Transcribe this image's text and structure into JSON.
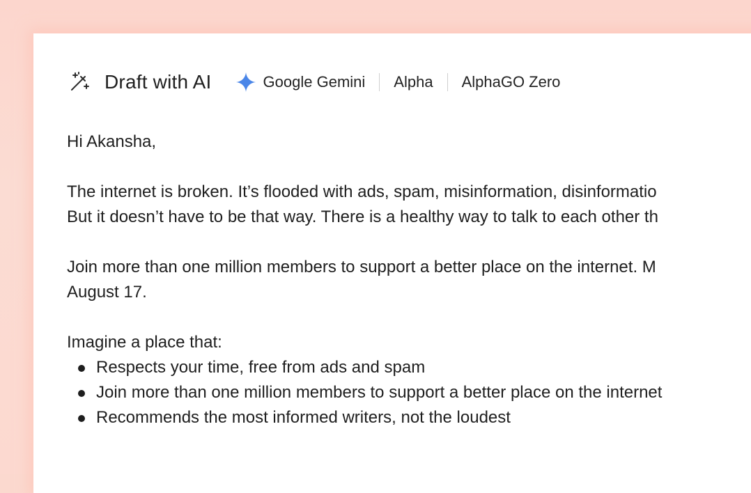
{
  "toolbar": {
    "title": "Draft with AI",
    "icon": "magic-wand-icon",
    "models": [
      {
        "label": "Google Gemini",
        "icon": "gemini-sparkle-icon",
        "icon_color": "#4a86e8"
      },
      {
        "label": "Alpha"
      },
      {
        "label": "AlphaGO Zero"
      }
    ]
  },
  "email": {
    "greeting": "Hi Akansha,",
    "paragraph1_line1": "The internet is broken. It’s flooded with ads, spam, misinformation, disinformatio",
    "paragraph1_line2": "But it doesn’t have to be that way. There is a healthy way to talk to each other th",
    "paragraph2_line1": "Join more than one million members to support a better place on the internet. M",
    "paragraph2_line2": "August 17.",
    "list_intro": "Imagine a place that:",
    "bullets": [
      "Respects your time, free from ads and spam",
      "Join more than one million members to support a better place on the internet",
      "Recommends the most informed writers, not the loudest"
    ]
  },
  "colors": {
    "background": "#fbd9cf",
    "card": "#ffffff",
    "text": "#1e1e1e",
    "accent": "#4a86e8"
  }
}
